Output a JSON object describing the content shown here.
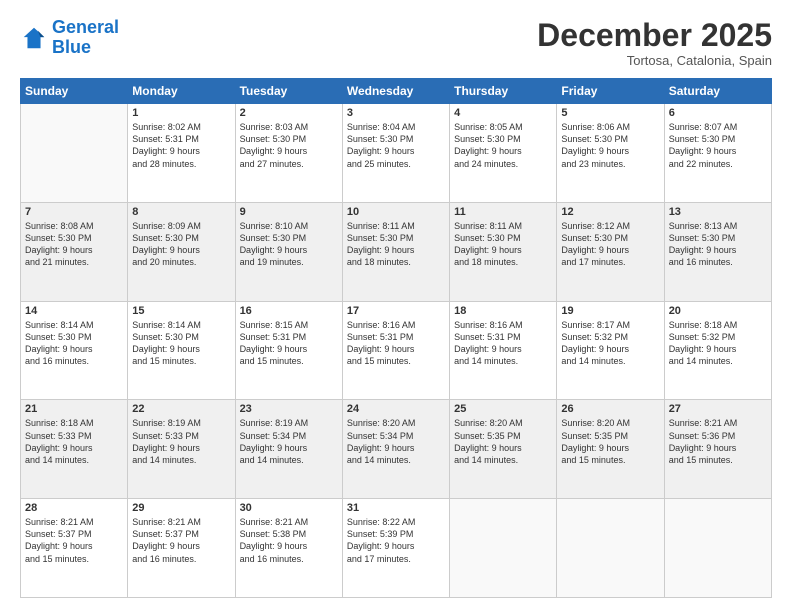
{
  "logo": {
    "line1": "General",
    "line2": "Blue"
  },
  "title": "December 2025",
  "subtitle": "Tortosa, Catalonia, Spain",
  "days_of_week": [
    "Sunday",
    "Monday",
    "Tuesday",
    "Wednesday",
    "Thursday",
    "Friday",
    "Saturday"
  ],
  "weeks": [
    [
      {
        "day": "",
        "info": ""
      },
      {
        "day": "1",
        "info": "Sunrise: 8:02 AM\nSunset: 5:31 PM\nDaylight: 9 hours\nand 28 minutes."
      },
      {
        "day": "2",
        "info": "Sunrise: 8:03 AM\nSunset: 5:30 PM\nDaylight: 9 hours\nand 27 minutes."
      },
      {
        "day": "3",
        "info": "Sunrise: 8:04 AM\nSunset: 5:30 PM\nDaylight: 9 hours\nand 25 minutes."
      },
      {
        "day": "4",
        "info": "Sunrise: 8:05 AM\nSunset: 5:30 PM\nDaylight: 9 hours\nand 24 minutes."
      },
      {
        "day": "5",
        "info": "Sunrise: 8:06 AM\nSunset: 5:30 PM\nDaylight: 9 hours\nand 23 minutes."
      },
      {
        "day": "6",
        "info": "Sunrise: 8:07 AM\nSunset: 5:30 PM\nDaylight: 9 hours\nand 22 minutes."
      }
    ],
    [
      {
        "day": "7",
        "info": "Sunrise: 8:08 AM\nSunset: 5:30 PM\nDaylight: 9 hours\nand 21 minutes."
      },
      {
        "day": "8",
        "info": "Sunrise: 8:09 AM\nSunset: 5:30 PM\nDaylight: 9 hours\nand 20 minutes."
      },
      {
        "day": "9",
        "info": "Sunrise: 8:10 AM\nSunset: 5:30 PM\nDaylight: 9 hours\nand 19 minutes."
      },
      {
        "day": "10",
        "info": "Sunrise: 8:11 AM\nSunset: 5:30 PM\nDaylight: 9 hours\nand 18 minutes."
      },
      {
        "day": "11",
        "info": "Sunrise: 8:11 AM\nSunset: 5:30 PM\nDaylight: 9 hours\nand 18 minutes."
      },
      {
        "day": "12",
        "info": "Sunrise: 8:12 AM\nSunset: 5:30 PM\nDaylight: 9 hours\nand 17 minutes."
      },
      {
        "day": "13",
        "info": "Sunrise: 8:13 AM\nSunset: 5:30 PM\nDaylight: 9 hours\nand 16 minutes."
      }
    ],
    [
      {
        "day": "14",
        "info": "Sunrise: 8:14 AM\nSunset: 5:30 PM\nDaylight: 9 hours\nand 16 minutes."
      },
      {
        "day": "15",
        "info": "Sunrise: 8:14 AM\nSunset: 5:30 PM\nDaylight: 9 hours\nand 15 minutes."
      },
      {
        "day": "16",
        "info": "Sunrise: 8:15 AM\nSunset: 5:31 PM\nDaylight: 9 hours\nand 15 minutes."
      },
      {
        "day": "17",
        "info": "Sunrise: 8:16 AM\nSunset: 5:31 PM\nDaylight: 9 hours\nand 15 minutes."
      },
      {
        "day": "18",
        "info": "Sunrise: 8:16 AM\nSunset: 5:31 PM\nDaylight: 9 hours\nand 14 minutes."
      },
      {
        "day": "19",
        "info": "Sunrise: 8:17 AM\nSunset: 5:32 PM\nDaylight: 9 hours\nand 14 minutes."
      },
      {
        "day": "20",
        "info": "Sunrise: 8:18 AM\nSunset: 5:32 PM\nDaylight: 9 hours\nand 14 minutes."
      }
    ],
    [
      {
        "day": "21",
        "info": "Sunrise: 8:18 AM\nSunset: 5:33 PM\nDaylight: 9 hours\nand 14 minutes."
      },
      {
        "day": "22",
        "info": "Sunrise: 8:19 AM\nSunset: 5:33 PM\nDaylight: 9 hours\nand 14 minutes."
      },
      {
        "day": "23",
        "info": "Sunrise: 8:19 AM\nSunset: 5:34 PM\nDaylight: 9 hours\nand 14 minutes."
      },
      {
        "day": "24",
        "info": "Sunrise: 8:20 AM\nSunset: 5:34 PM\nDaylight: 9 hours\nand 14 minutes."
      },
      {
        "day": "25",
        "info": "Sunrise: 8:20 AM\nSunset: 5:35 PM\nDaylight: 9 hours\nand 14 minutes."
      },
      {
        "day": "26",
        "info": "Sunrise: 8:20 AM\nSunset: 5:35 PM\nDaylight: 9 hours\nand 15 minutes."
      },
      {
        "day": "27",
        "info": "Sunrise: 8:21 AM\nSunset: 5:36 PM\nDaylight: 9 hours\nand 15 minutes."
      }
    ],
    [
      {
        "day": "28",
        "info": "Sunrise: 8:21 AM\nSunset: 5:37 PM\nDaylight: 9 hours\nand 15 minutes."
      },
      {
        "day": "29",
        "info": "Sunrise: 8:21 AM\nSunset: 5:37 PM\nDaylight: 9 hours\nand 16 minutes."
      },
      {
        "day": "30",
        "info": "Sunrise: 8:21 AM\nSunset: 5:38 PM\nDaylight: 9 hours\nand 16 minutes."
      },
      {
        "day": "31",
        "info": "Sunrise: 8:22 AM\nSunset: 5:39 PM\nDaylight: 9 hours\nand 17 minutes."
      },
      {
        "day": "",
        "info": ""
      },
      {
        "day": "",
        "info": ""
      },
      {
        "day": "",
        "info": ""
      }
    ]
  ]
}
